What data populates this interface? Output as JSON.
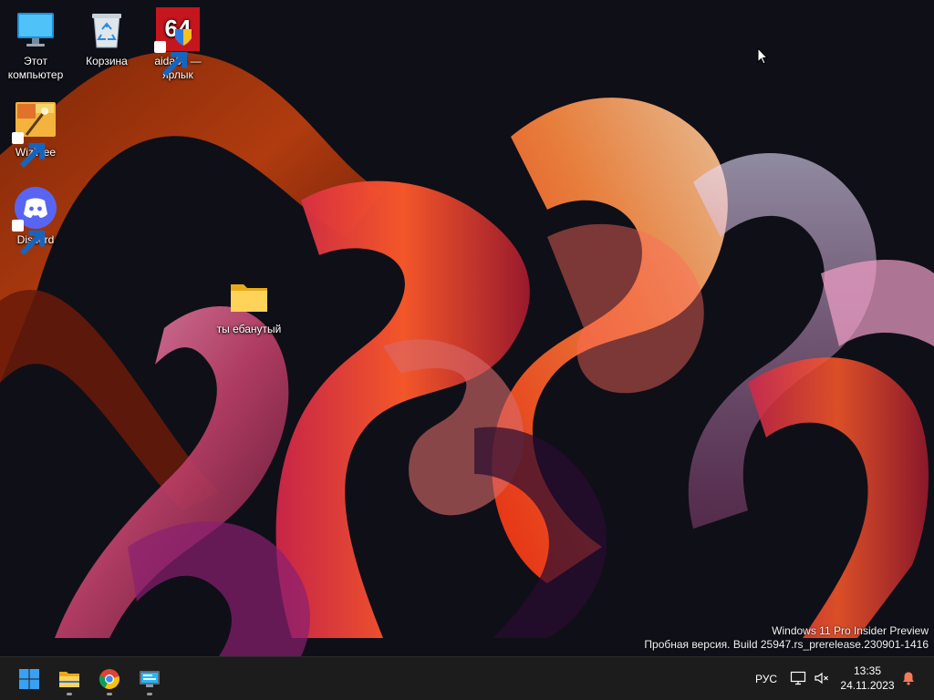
{
  "desktop": {
    "icons": [
      {
        "label": "Этот компьютер",
        "icon": "this-pc-icon"
      },
      {
        "label": "Корзина",
        "icon": "recycle-bin-icon"
      },
      {
        "label": "aida64 — ярлык",
        "icon": "aida64-icon",
        "badge": "64"
      },
      {
        "label": "WizTree",
        "icon": "wiztree-icon"
      },
      {
        "label": "Discord",
        "icon": "discord-icon"
      },
      {
        "label": "ты ебанутый",
        "icon": "folder-icon"
      }
    ]
  },
  "watermark": {
    "line1": "Windows 11 Pro Insider Preview",
    "line2": "Пробная версия. Build 25947.rs_prerelease.230901-1416"
  },
  "taskbar": {
    "apps": [
      {
        "name": "Start",
        "icon": "windows-start-icon"
      },
      {
        "name": "File Explorer",
        "icon": "file-explorer-icon",
        "running": true
      },
      {
        "name": "Google Chrome",
        "icon": "chrome-icon",
        "running": true
      },
      {
        "name": "Remote Desktop",
        "icon": "remote-desktop-icon",
        "running": true
      }
    ],
    "tray": {
      "language": "РУС",
      "time": "13:35",
      "date": "24.11.2023"
    }
  },
  "colors": {
    "taskbar_bg": "#1c1c1c",
    "accent": "#3aa0f3",
    "wallpaper_dark": "#0e0e16"
  }
}
